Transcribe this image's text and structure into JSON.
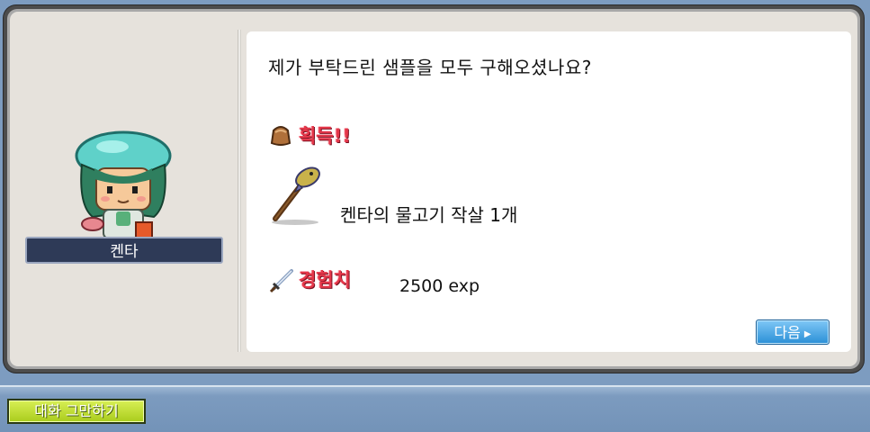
{
  "npc": {
    "name": "켄타"
  },
  "dialog": {
    "question": "제가 부탁드린 샘플을 모두 구해오셨나요?",
    "acquire_label": "획득!!",
    "item": {
      "icon": "fish-harpoon-icon",
      "name": "켄타의 물고기 작살 1개"
    },
    "exp": {
      "label": "경험치",
      "value": "2500 exp"
    },
    "next_label": "다음"
  },
  "bottom": {
    "end_chat_label": "대화 그만하기"
  },
  "colors": {
    "label_red": "#e5374a",
    "next_button": "#2a8fd6",
    "end_chat_button": "#a9cc1c",
    "name_plate": "#2e3a57"
  }
}
